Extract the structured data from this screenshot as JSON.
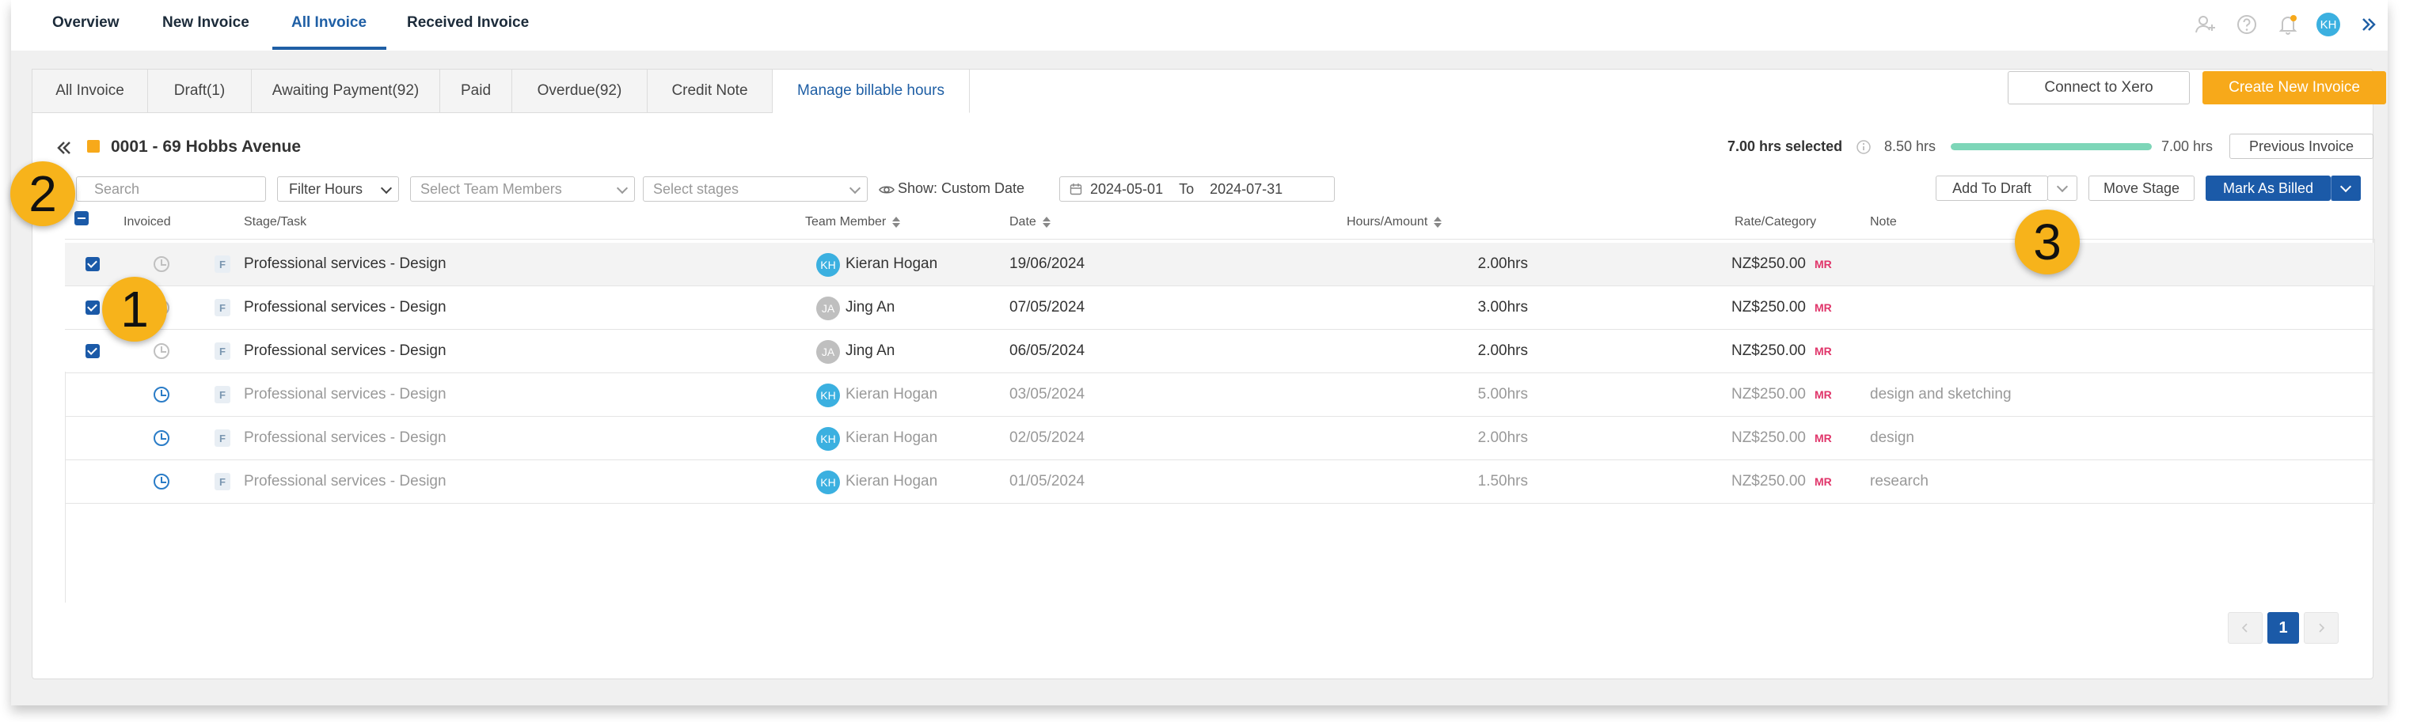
{
  "topnav": {
    "items": [
      "Overview",
      "New Invoice",
      "All Invoice",
      "Received Invoice"
    ],
    "active": "All Invoice",
    "avatar": "KH",
    "accent": "#1f5fa5"
  },
  "tabs": [
    "All Invoice",
    "Draft(1)",
    "Awaiting Payment(92)",
    "Paid",
    "Overdue(92)",
    "Credit Note",
    "Manage billable hours"
  ],
  "header_buttons": {
    "connect_xero": "Connect to Xero",
    "create_invoice": "Create New Invoice"
  },
  "project": {
    "title": "0001 - 69 Hobbs Avenue",
    "color": "#f7a91a"
  },
  "summary": {
    "selected": "7.00 hrs selected",
    "left_hours": "8.50 hrs",
    "right_hours": "7.00 hrs",
    "progress": 1.0,
    "prev_invoice": "Previous Invoice"
  },
  "filters": {
    "search_placeholder": "Search",
    "filter_hours": "Filter Hours",
    "team_placeholder": "Select Team Members",
    "stages_placeholder": "Select stages",
    "show_label": "Show: Custom Date",
    "date_from": "2024-05-01",
    "date_to_label": "To",
    "date_to": "2024-07-31"
  },
  "actions": {
    "add_to_draft": "Add To Draft",
    "move_stage": "Move Stage",
    "mark_billed": "Mark As Billed"
  },
  "columns": {
    "invoiced": "Invoiced",
    "stage": "Stage/Task",
    "member": "Team Member",
    "date": "Date",
    "hours": "Hours/Amount",
    "rate": "Rate/Category",
    "note": "Note"
  },
  "rows": [
    {
      "checked": true,
      "task": "Professional services - Design",
      "member": "Kieran Hogan",
      "initials": "KH",
      "date": "19/06/2024",
      "hours": "2.00hrs",
      "rate": "NZ$250.00",
      "cat": "MR",
      "note": ""
    },
    {
      "checked": true,
      "task": "Professional services - Design",
      "member": "Jing An",
      "initials": "JA",
      "date": "07/05/2024",
      "hours": "3.00hrs",
      "rate": "NZ$250.00",
      "cat": "MR",
      "note": ""
    },
    {
      "checked": true,
      "task": "Professional services - Design",
      "member": "Jing An",
      "initials": "JA",
      "date": "06/05/2024",
      "hours": "2.00hrs",
      "rate": "NZ$250.00",
      "cat": "MR",
      "note": ""
    },
    {
      "checked": false,
      "task": "Professional services - Design",
      "member": "Kieran Hogan",
      "initials": "KH",
      "date": "03/05/2024",
      "hours": "5.00hrs",
      "rate": "NZ$250.00",
      "cat": "MR",
      "note": "design and sketching"
    },
    {
      "checked": false,
      "task": "Professional services - Design",
      "member": "Kieran Hogan",
      "initials": "KH",
      "date": "02/05/2024",
      "hours": "2.00hrs",
      "rate": "NZ$250.00",
      "cat": "MR",
      "note": "design"
    },
    {
      "checked": false,
      "task": "Professional services - Design",
      "member": "Kieran Hogan",
      "initials": "KH",
      "date": "01/05/2024",
      "hours": "1.50hrs",
      "rate": "NZ$250.00",
      "cat": "MR",
      "note": "research"
    }
  ],
  "fbadge": "F",
  "pagination": {
    "current": "1"
  },
  "callouts": [
    "1",
    "2",
    "3"
  ]
}
